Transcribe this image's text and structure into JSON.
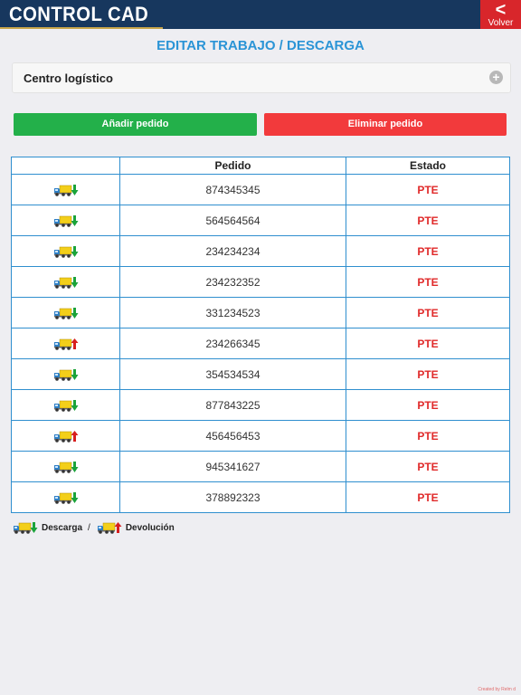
{
  "header": {
    "app_title": "CONTROL CAD",
    "back_label": "Volver"
  },
  "page": {
    "heading": "EDITAR TRABAJO / DESCARGA"
  },
  "select": {
    "label": "Centro logístico"
  },
  "actions": {
    "add_label": "Añadir pedido",
    "delete_label": "Eliminar pedido"
  },
  "table": {
    "headers": [
      "",
      "Pedido",
      "Estado"
    ],
    "rows": [
      {
        "type": "descarga",
        "pedido": "874345345",
        "estado": "PTE"
      },
      {
        "type": "descarga",
        "pedido": "564564564",
        "estado": "PTE"
      },
      {
        "type": "descarga",
        "pedido": "234234234",
        "estado": "PTE"
      },
      {
        "type": "descarga",
        "pedido": "234232352",
        "estado": "PTE"
      },
      {
        "type": "descarga",
        "pedido": "331234523",
        "estado": "PTE"
      },
      {
        "type": "devolucion",
        "pedido": "234266345",
        "estado": "PTE"
      },
      {
        "type": "descarga",
        "pedido": "354534534",
        "estado": "PTE"
      },
      {
        "type": "descarga",
        "pedido": "877843225",
        "estado": "PTE"
      },
      {
        "type": "devolucion",
        "pedido": "456456453",
        "estado": "PTE"
      },
      {
        "type": "descarga",
        "pedido": "945341627",
        "estado": "PTE"
      },
      {
        "type": "descarga",
        "pedido": "378892323",
        "estado": "PTE"
      }
    ]
  },
  "legend": {
    "descarga_label": "Descarga",
    "separator": "/",
    "devolucion_label": "Devolución"
  },
  "credit": "Created by Relm d",
  "icons": {
    "descarga": "truck-download-icon",
    "devolucion": "truck-return-icon",
    "add": "plus-icon",
    "back": "chevron-left-icon"
  },
  "colors": {
    "header": "#17375e",
    "back": "#d8262b",
    "accent": "#2a94d6",
    "add": "#23b04a",
    "delete": "#f23a3c",
    "status": "#e02a2a"
  }
}
